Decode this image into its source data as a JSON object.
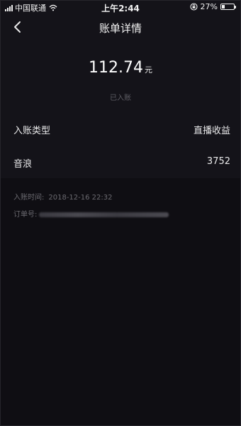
{
  "status_bar": {
    "carrier": "中国联通",
    "time": "上午2:44",
    "battery": "27%",
    "battery_level": 0.27
  },
  "nav": {
    "title": "账单详情"
  },
  "summary": {
    "amount": "112.74",
    "unit": "元",
    "status": "已入账"
  },
  "details": [
    {
      "label": "入账类型",
      "value": "直播收益"
    },
    {
      "label": "音浪",
      "value": "3752"
    }
  ],
  "meta": {
    "time_label": "入账时间:",
    "time_value": "2018-12-16 22:32",
    "order_label": "订单号:"
  }
}
